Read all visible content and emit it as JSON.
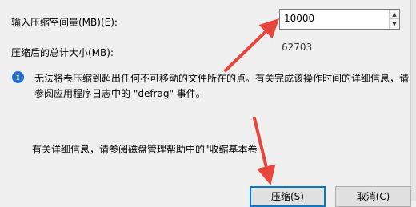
{
  "form": {
    "shrink_label": "输入压缩空间量(MB)(E):",
    "shrink_value": "10000",
    "spin_up": "▲",
    "spin_down": "▼",
    "total_label": "压缩后的总计大小(MB):",
    "total_value": "62703"
  },
  "info": {
    "line1": "无法将卷压缩到超出任何不可移动的文件所在的点。有关完成该操作时间的详细信息，请",
    "line2": "参阅应用程序日志中的 \"defrag\" 事件。"
  },
  "help": {
    "text": "有关详细信息，请参阅磁盘管理帮助中的\"收缩基本卷"
  },
  "buttons": {
    "shrink": "压缩(S)",
    "cancel": "取消(C)"
  },
  "colors": {
    "arrow": "#e8453c",
    "info_icon": "#1f6fd1",
    "focus_border": "#0078d7"
  }
}
